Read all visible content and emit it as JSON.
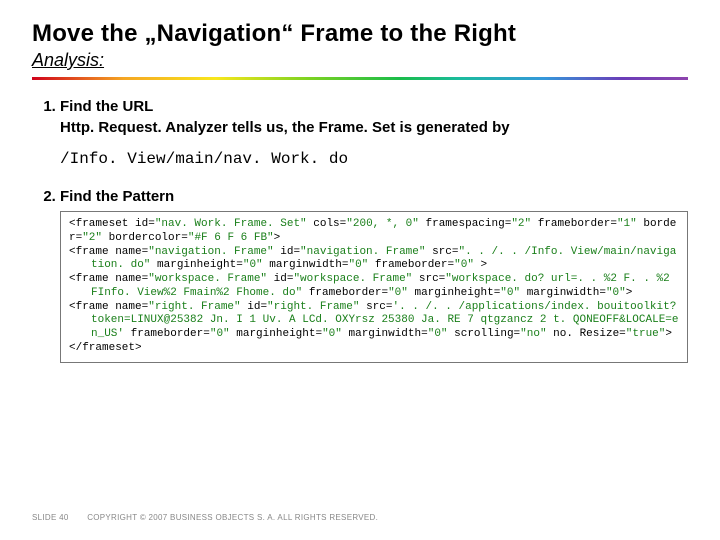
{
  "title": "Move the „Navigation“ Frame to the Right",
  "subtitle": "Analysis:",
  "steps": [
    {
      "marker": "1.",
      "heading": "Find the URL",
      "body": "Http. Request. Analyzer tells us, the Frame. Set is generated by",
      "path": "/Info. View/main/nav. Work. do"
    },
    {
      "marker": "2.",
      "heading": "Find the Pattern"
    }
  ],
  "code": {
    "l0a": "<frameset id=",
    "l0v1": "\"nav. Work. Frame. Set\"",
    "l0b": " cols=",
    "l0v2": "\"200, *, 0\"",
    "l0c": " framespacing=",
    "l0v3": "\"2\"",
    "l0d": " frameborder=",
    "l0v4": "\"1\"",
    "l0e": " border=",
    "l0v5": "\"2\"",
    "l0f": " bordercolor=",
    "l0v6": "\"#F 6 F 6 FB\"",
    "l0g": ">",
    "l1a": "<frame name=",
    "l1v1": "\"navigation. Frame\"",
    "l1b": " id=",
    "l1v2": "\"navigation. Frame\"",
    "l1c": " src=",
    "l1v3": "\". . /. . /Info. View/main/navigation. do\"",
    "l1d": " marginheight=",
    "l1v4": "\"0\"",
    "l1e": " marginwidth=",
    "l1v5": "\"0\"",
    "l1f": " frameborder=",
    "l1v6": "\"0\"",
    "l1g": " >",
    "l2a": "<frame name=",
    "l2v1": "\"workspace. Frame\"",
    "l2b": " id=",
    "l2v2": "\"workspace. Frame\"",
    "l2c": " src=",
    "l2v3": "\"workspace. do? url=. . %2 F. . %2 FInfo. View%2 Fmain%2 Fhome. do\"",
    "l2d": " frameborder=",
    "l2v4": "\"0\"",
    "l2e": " marginheight=",
    "l2v5": "\"0\"",
    "l2f": " marginwidth=",
    "l2v6": "\"0\"",
    "l2g": ">",
    "l3a": "<frame name=",
    "l3v1": "\"right. Frame\"",
    "l3b": " id=",
    "l3v2": "\"right. Frame\"",
    "l3c": " src=",
    "l3v3": "'. . /. . /applications/index. bouitoolkit? token=LINUX@25382 Jn. I 1 Uv. A LCd. OXYrsz 25380 Ja. RE 7 qtgzancz 2 t. QONEOFF&LOCALE=en_US'",
    "l3d": " frameborder=",
    "l3v4": "\"0\"",
    "l3e": " marginheight=",
    "l3v5": "\"0\"",
    "l3f": " marginwidth=",
    "l3v6": "\"0\"",
    "l3g": " scrolling=",
    "l3v7": "\"no\"",
    "l3h": " no. Resize=",
    "l3v8": "\"true\"",
    "l3i": ">",
    "l4": "</frameset>"
  },
  "footer": {
    "slide": "SLIDE 40",
    "copyright": "COPYRIGHT © 2007 BUSINESS OBJECTS S. A.  ALL RIGHTS RESERVED."
  }
}
